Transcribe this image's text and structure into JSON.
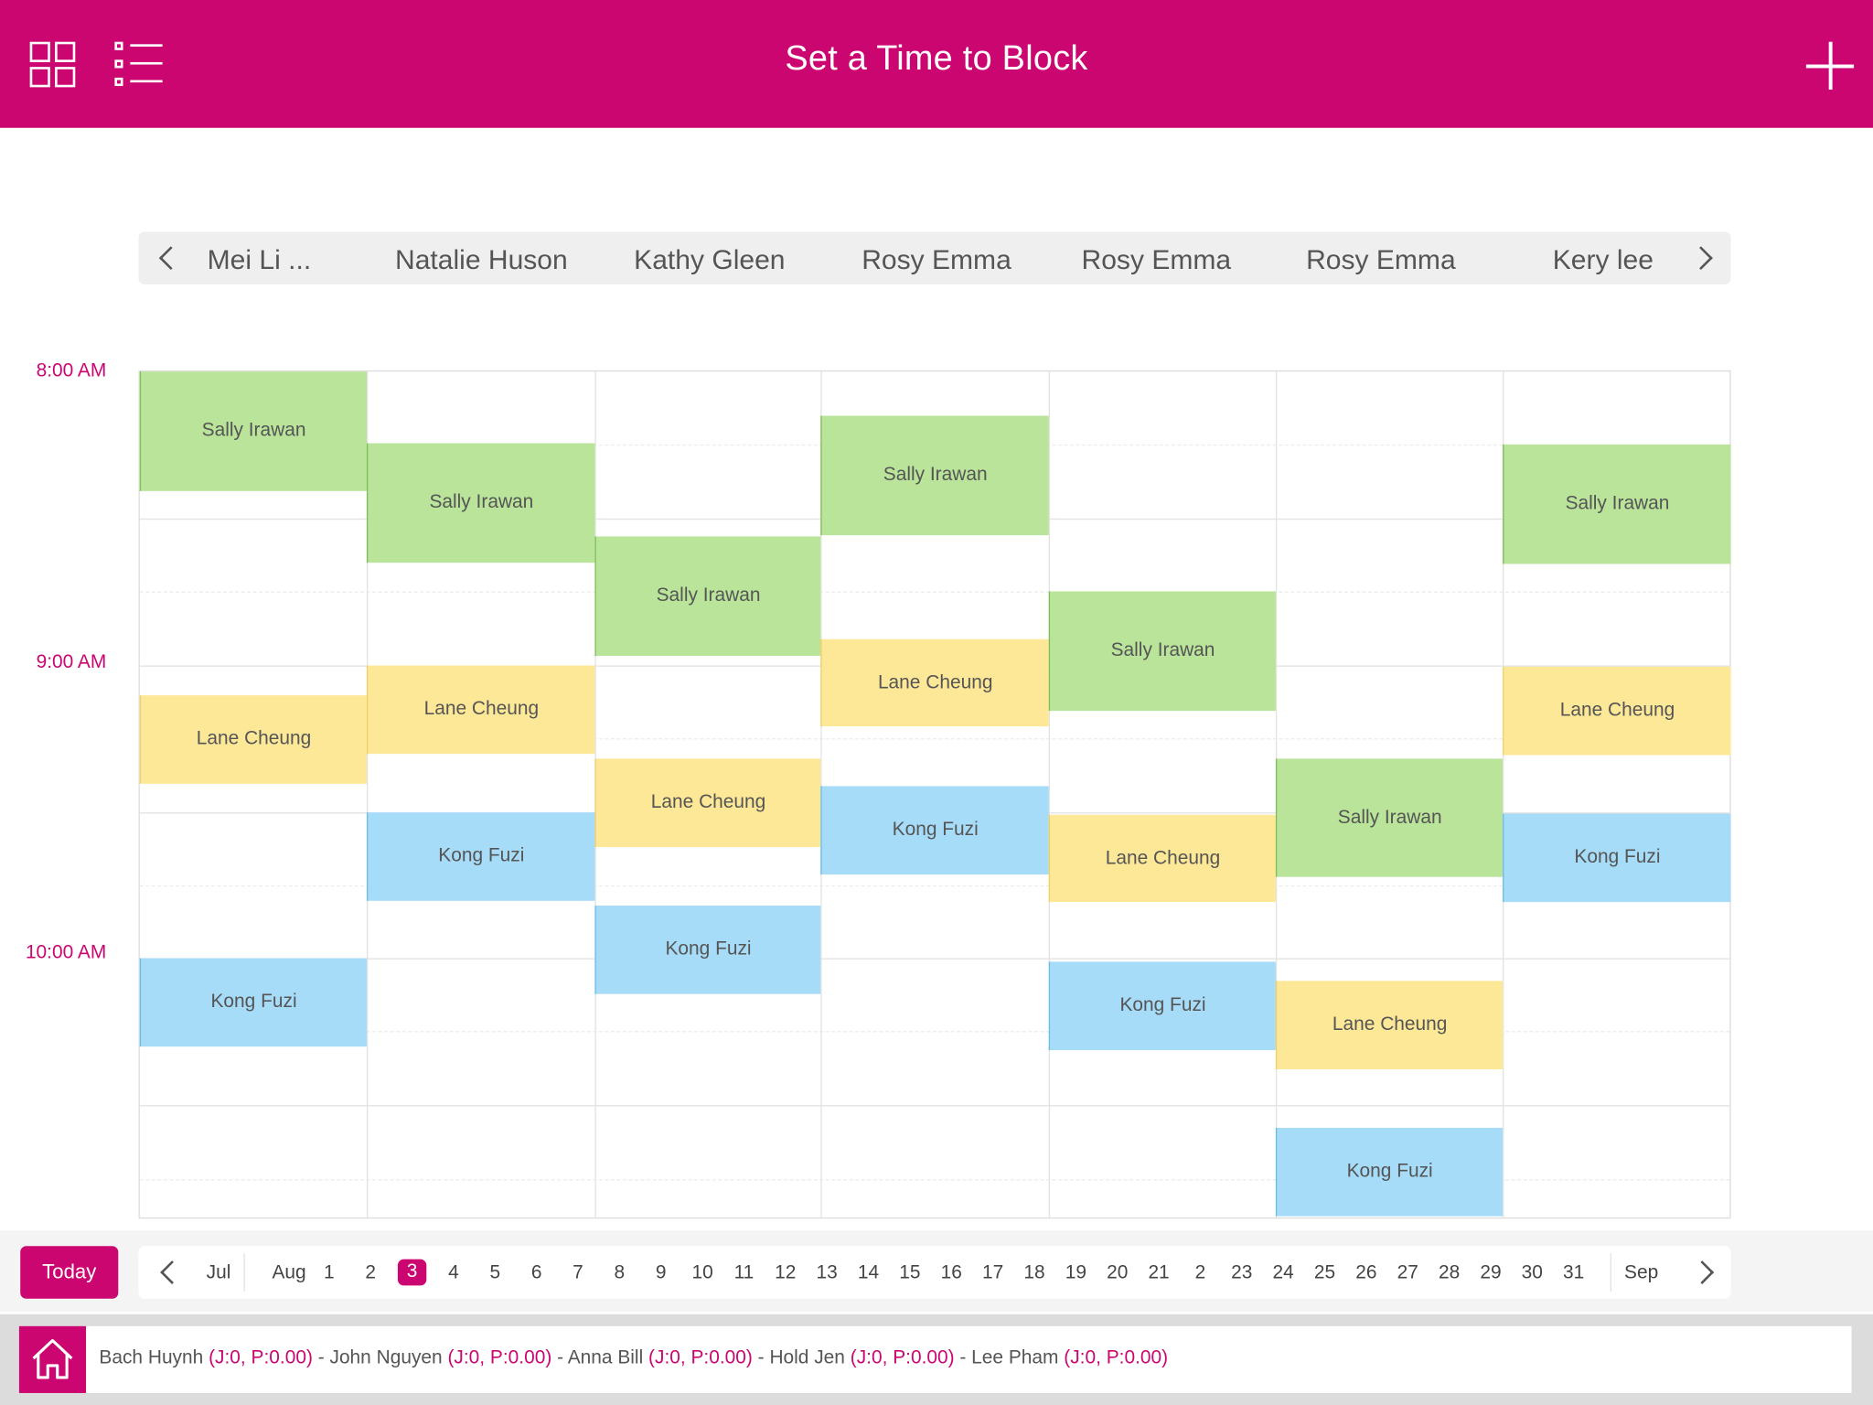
{
  "header": {
    "title": "Set a Time to Block",
    "left_icons": [
      "grid-view-icon",
      "list-view-icon"
    ],
    "right_icon": "plus-icon"
  },
  "staff": [
    "Mei Li ...",
    "Natalie Huson",
    "Kathy Gleen",
    "Rosy Emma",
    "Rosy Emma",
    "Rosy Emma",
    "Kery lee"
  ],
  "time_labels": [
    "8:00 AM",
    "9:00 AM",
    "10:00 AM"
  ],
  "events": [
    {
      "col": 0,
      "label": "Sally Irawan",
      "color": "green"
    },
    {
      "col": 0,
      "label": "Lane Cheung",
      "color": "yellow"
    },
    {
      "col": 0,
      "label": "Kong Fuzi",
      "color": "blue"
    },
    {
      "col": 1,
      "label": "Sally Irawan",
      "color": "green"
    },
    {
      "col": 1,
      "label": "Lane Cheung",
      "color": "yellow"
    },
    {
      "col": 1,
      "label": "Kong Fuzi",
      "color": "blue"
    },
    {
      "col": 2,
      "label": "Sally Irawan",
      "color": "green"
    },
    {
      "col": 2,
      "label": "Lane Cheung",
      "color": "yellow"
    },
    {
      "col": 2,
      "label": "Kong Fuzi",
      "color": "blue"
    },
    {
      "col": 3,
      "label": "Sally Irawan",
      "color": "green"
    },
    {
      "col": 3,
      "label": "Lane Cheung",
      "color": "yellow"
    },
    {
      "col": 3,
      "label": "Kong Fuzi",
      "color": "blue"
    },
    {
      "col": 4,
      "label": "Sally Irawan",
      "color": "green"
    },
    {
      "col": 4,
      "label": "Lane Cheung",
      "color": "yellow"
    },
    {
      "col": 4,
      "label": "Kong Fuzi",
      "color": "blue"
    },
    {
      "col": 5,
      "label": "Sally Irawan",
      "color": "green"
    },
    {
      "col": 5,
      "label": "Lane Cheung",
      "color": "yellow"
    },
    {
      "col": 5,
      "label": "Kong Fuzi",
      "color": "blue"
    },
    {
      "col": 6,
      "label": "Sally Irawan",
      "color": "green"
    },
    {
      "col": 6,
      "label": "Lane Cheung",
      "color": "yellow"
    },
    {
      "col": 6,
      "label": "Kong Fuzi",
      "color": "blue"
    }
  ],
  "datebar": {
    "today_label": "Today",
    "prev_month": "Jul",
    "current_month": "Aug",
    "next_month": "Sep",
    "days": [
      "1",
      "2",
      "3",
      "4",
      "5",
      "6",
      "7",
      "8",
      "9",
      "10",
      "11",
      "12",
      "13",
      "14",
      "15",
      "16",
      "17",
      "18",
      "19",
      "20",
      "21",
      "2",
      "23",
      "24",
      "25",
      "26",
      "27",
      "28",
      "29",
      "30",
      "31"
    ],
    "selected_day": "3"
  },
  "footer": {
    "icon": "home-icon",
    "entries": [
      {
        "name": "Bach Huynh",
        "stats": "(J:0, P:0.00)"
      },
      {
        "name": "John Nguyen",
        "stats": "(J:0, P:0.00)"
      },
      {
        "name": "Anna Bill",
        "stats": "(J:0, P:0.00)"
      },
      {
        "name": "Hold Jen",
        "stats": "(J:0, P:0.00)"
      },
      {
        "name": "Lee Pham",
        "stats": "(J:0, P:0.00)"
      }
    ],
    "separator": " - "
  },
  "colors": {
    "brand": "#cc0670",
    "green_event": "#b9e49a",
    "yellow_event": "#fde898",
    "blue_event": "#a7dcf9"
  }
}
